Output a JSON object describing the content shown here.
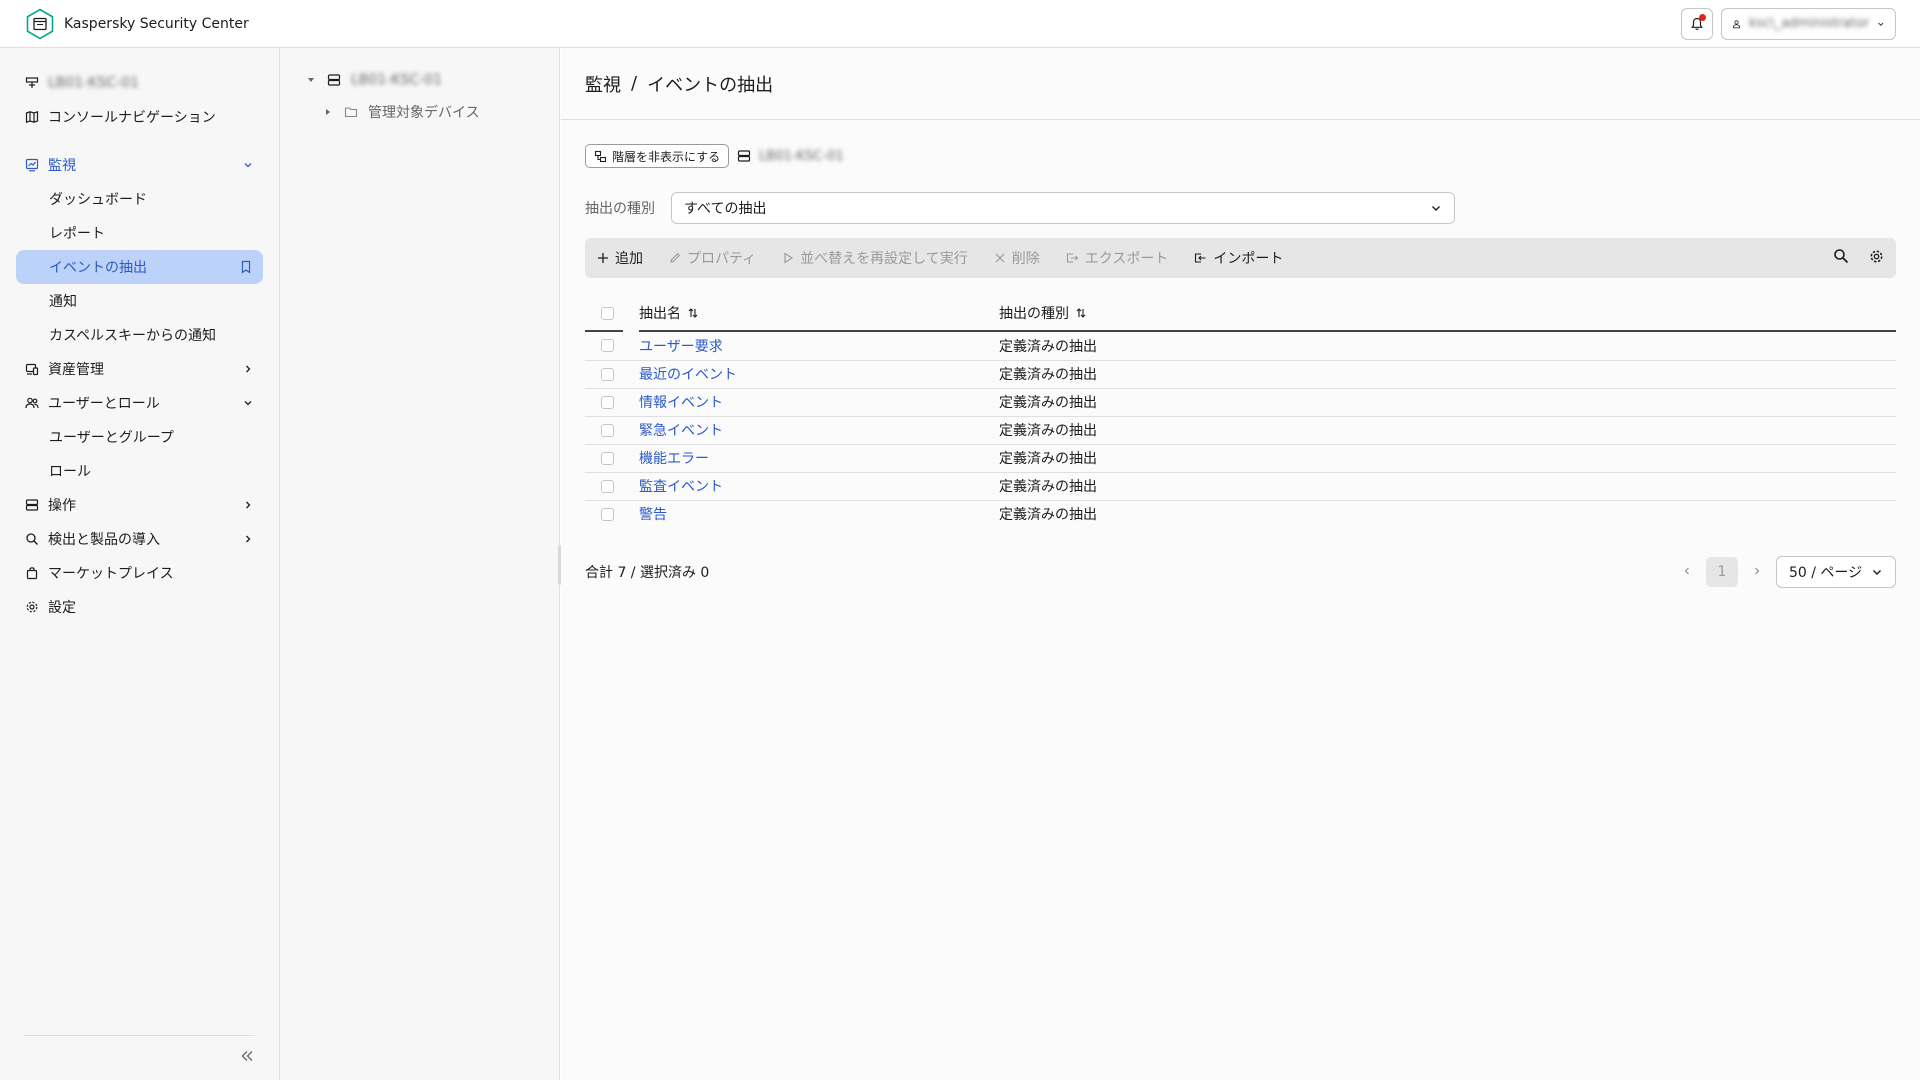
{
  "app": {
    "title": "Kaspersky Security Center"
  },
  "header": {
    "user_name": "ksc\\_administrator"
  },
  "sidebar": {
    "server_name": "LB01-KSC-01",
    "items": [
      {
        "label": "コンソールナビゲーション",
        "icon": "map-icon"
      },
      {
        "label": "監視",
        "icon": "monitor-chart-icon"
      },
      {
        "label": "ダッシュボード"
      },
      {
        "label": "レポート"
      },
      {
        "label": "イベントの抽出"
      },
      {
        "label": "通知"
      },
      {
        "label": "カスペルスキーからの通知"
      },
      {
        "label": "資産管理",
        "icon": "devices-icon"
      },
      {
        "label": "ユーザーとロール",
        "icon": "users-icon"
      },
      {
        "label": "ユーザーとグループ"
      },
      {
        "label": "ロール"
      },
      {
        "label": "操作",
        "icon": "server-icon"
      },
      {
        "label": "検出と製品の導入",
        "icon": "search-icon"
      },
      {
        "label": "マーケットプレイス",
        "icon": "bag-icon"
      },
      {
        "label": "設定",
        "icon": "gear-icon"
      }
    ]
  },
  "tree": {
    "server_name": "LB01-KSC-01",
    "child_label": "管理対象デバイス"
  },
  "breadcrumb": {
    "parent": "監視",
    "separator": "/",
    "current": "イベントの抽出"
  },
  "hierarchy": {
    "button_label": "階層を非表示にする",
    "server_name": "LB01-KSC-01"
  },
  "filter": {
    "label": "抽出の種別",
    "selected": "すべての抽出"
  },
  "toolbar": {
    "add": "追加",
    "properties": "プロパティ",
    "reorder_run": "並べ替えを再設定して実行",
    "delete": "削除",
    "export": "エクスポート",
    "import": "インポート"
  },
  "table": {
    "headers": {
      "name": "抽出名",
      "type": "抽出の種別"
    },
    "rows": [
      {
        "name": "ユーザー要求",
        "type": "定義済みの抽出"
      },
      {
        "name": "最近のイベント",
        "type": "定義済みの抽出"
      },
      {
        "name": "情報イベント",
        "type": "定義済みの抽出"
      },
      {
        "name": "緊急イベント",
        "type": "定義済みの抽出"
      },
      {
        "name": "機能エラー",
        "type": "定義済みの抽出"
      },
      {
        "name": "監査イベント",
        "type": "定義済みの抽出"
      },
      {
        "name": "警告",
        "type": "定義済みの抽出"
      }
    ]
  },
  "footer": {
    "total": "合計 7 / 選択済み 0",
    "page": "1",
    "per_page": "50 / ページ"
  },
  "colors": {
    "accent": "#2c5ac8",
    "selected_bg": "#bcd2f8",
    "brand": "#00a88e"
  }
}
